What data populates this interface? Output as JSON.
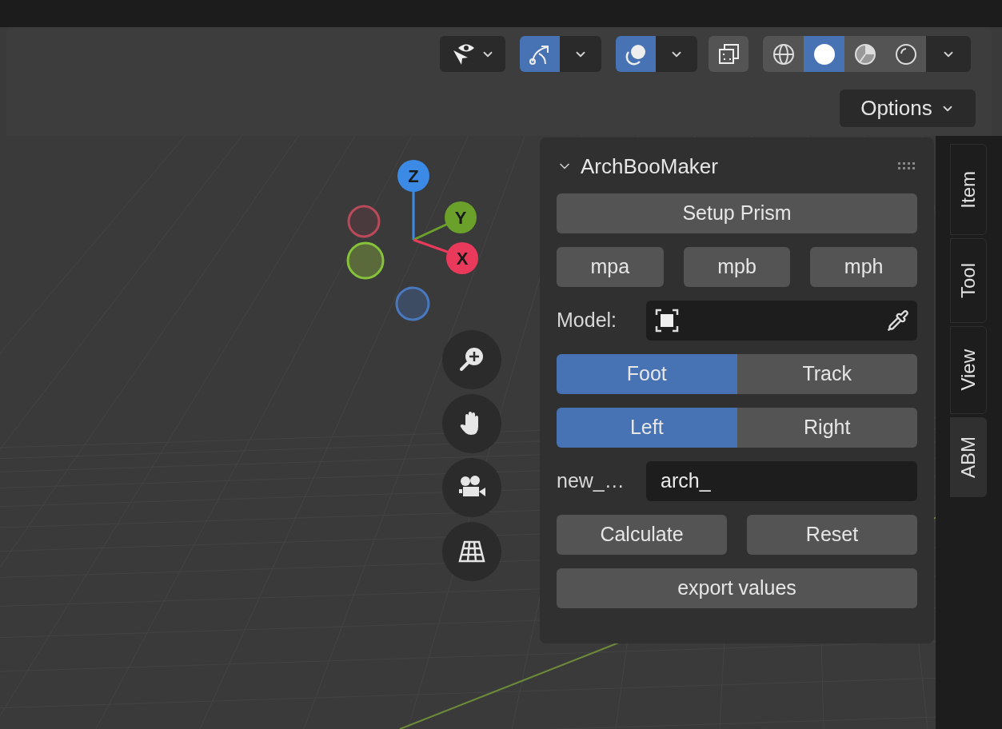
{
  "toolbar": {
    "gizmo_toggle": {
      "on": true
    },
    "overlay_toggle": {
      "on": true
    },
    "xray_toggle": {
      "on": false
    },
    "shading_modes": [
      {
        "kind": "wireframe",
        "selected": false
      },
      {
        "kind": "solid",
        "selected": true
      },
      {
        "kind": "material",
        "selected": false
      },
      {
        "kind": "rendered",
        "selected": false
      }
    ]
  },
  "options_button": "Options",
  "gizmo": {
    "axes": [
      {
        "label": "Z",
        "color": "#3b8ae6"
      },
      {
        "label": "Y",
        "color": "#6ba12a"
      },
      {
        "label": "X",
        "color": "#ea3a5c"
      }
    ]
  },
  "panel": {
    "title": "ArchBooMaker",
    "expanded": true,
    "rows": [
      {
        "kind": "buttons",
        "buttons": [
          "Setup Prism"
        ]
      },
      {
        "kind": "buttons",
        "buttons": [
          "mpa",
          "mpb",
          "mph"
        ]
      },
      {
        "kind": "object_field",
        "label": "Model:"
      },
      {
        "kind": "toggle",
        "options": [
          {
            "label": "Foot",
            "selected": true
          },
          {
            "label": "Track",
            "selected": false
          }
        ]
      },
      {
        "kind": "toggle",
        "options": [
          {
            "label": "Left",
            "selected": true
          },
          {
            "label": "Right",
            "selected": false
          }
        ]
      },
      {
        "kind": "text_field",
        "label": "new_…",
        "value": "arch_"
      },
      {
        "kind": "buttons",
        "buttons": [
          "Calculate",
          "Reset"
        ]
      },
      {
        "kind": "buttons",
        "buttons": [
          "export values"
        ]
      }
    ]
  },
  "sidebar_tabs": [
    {
      "label": "Item",
      "selected": false
    },
    {
      "label": "Tool",
      "selected": false
    },
    {
      "label": "View",
      "selected": false
    },
    {
      "label": "ABM",
      "selected": true
    }
  ]
}
